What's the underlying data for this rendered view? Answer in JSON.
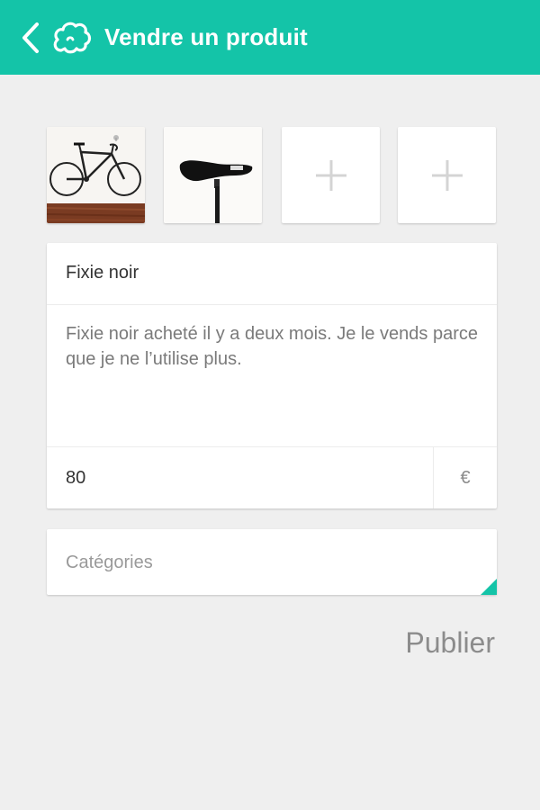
{
  "appbar": {
    "title": "Vendre un produit",
    "back_icon": "chevron-left-icon",
    "logo_icon": "cloud-logo-icon",
    "color": "#14c4a8"
  },
  "photos": [
    {
      "kind": "image",
      "subject": "fixie-bicycle"
    },
    {
      "kind": "image",
      "subject": "bicycle-saddle"
    },
    {
      "kind": "add",
      "icon": "plus-icon"
    },
    {
      "kind": "add",
      "icon": "plus-icon"
    }
  ],
  "form": {
    "title_value": "Fixie noir",
    "description_value": "Fixie noir acheté il y a deux mois. Je le vends parce que je ne l’utilise plus.",
    "price_value": "80",
    "currency": "€",
    "categories_placeholder": "Catégories"
  },
  "actions": {
    "publish_label": "Publier"
  }
}
